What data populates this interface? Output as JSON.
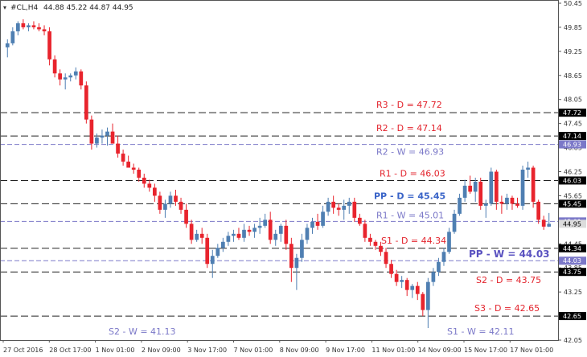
{
  "header": {
    "symbol": "#CL,H4",
    "ohlc": "44.88 45.22 44.87 44.95"
  },
  "colors": {
    "up": "#4f7fb2",
    "down": "#e8242d",
    "daily_line": "#222222",
    "weekly_line": "#7b78c8",
    "daily_label": "#e3242d",
    "weekly_label": "#7b78c8",
    "pp_daily": "#3a64c8",
    "pp_weekly": "#5a52c0",
    "axis_text": "#333333"
  },
  "chart_data": {
    "type": "candlestick",
    "ylim": [
      42.05,
      50.45
    ],
    "y_ticks": [
      "50.45",
      "49.85",
      "49.25",
      "48.65",
      "48.05",
      "47.45",
      "46.85",
      "46.25",
      "45.65",
      "45.05",
      "44.45",
      "43.85",
      "43.25",
      "42.65",
      "42.05"
    ],
    "x_ticks": [
      "27 Oct 2016",
      "28 Oct 17:00",
      "1 Nov 01:00",
      "2 Nov 09:00",
      "3 Nov 17:00",
      "7 Nov 01:00",
      "8 Nov 09:00",
      "9 Nov 17:00",
      "11 Nov 01:00",
      "14 Nov 09:00",
      "15 Nov 17:00",
      "17 Nov 01:00"
    ],
    "levels": [
      {
        "label": "R3 - D = 47.72",
        "value": 47.72,
        "kind": "daily",
        "axis_label": "47.72"
      },
      {
        "label": "R2 - D = 47.14",
        "value": 47.14,
        "kind": "daily",
        "axis_label": "47.14"
      },
      {
        "label": "R2 - W = 46.93",
        "value": 46.93,
        "kind": "weekly",
        "axis_label": "46.93"
      },
      {
        "label": "R1 - D = 46.03",
        "value": 46.03,
        "kind": "daily",
        "axis_label": "46.03"
      },
      {
        "label": "PP - D = 45.45",
        "value": 45.45,
        "kind": "pp_daily",
        "axis_label": "45.45"
      },
      {
        "label": "R1 - W = 45.01",
        "value": 45.01,
        "kind": "weekly",
        "axis_label": "45.01"
      },
      {
        "label": "S1 - D = 44.34",
        "value": 44.34,
        "kind": "daily",
        "axis_label": "44.34"
      },
      {
        "label": "PP - W = 44.03",
        "value": 44.03,
        "kind": "pp_weekly",
        "axis_label": "44.03"
      },
      {
        "label": "S2 - D = 43.75",
        "value": 43.75,
        "kind": "daily",
        "axis_label": "43.75"
      },
      {
        "label": "S3 - D = 42.65",
        "value": 42.65,
        "kind": "daily",
        "axis_label": "42.65"
      },
      {
        "label": "S2 - W = 41.13",
        "value": 41.13,
        "kind": "weekly_offscale"
      },
      {
        "label": "S1 - W = 42.11",
        "value": 42.11,
        "kind": "weekly_offscale"
      }
    ],
    "current_price": {
      "value": 44.95,
      "axis_label": "44.95"
    },
    "candles": [
      [
        49.35,
        49.55,
        49.1,
        49.45
      ],
      [
        49.45,
        49.85,
        49.4,
        49.75
      ],
      [
        49.75,
        50.0,
        49.65,
        49.95
      ],
      [
        49.95,
        50.05,
        49.8,
        49.85
      ],
      [
        49.85,
        49.95,
        49.75,
        49.9
      ],
      [
        49.9,
        50.0,
        49.8,
        49.85
      ],
      [
        49.85,
        49.95,
        49.75,
        49.8
      ],
      [
        49.8,
        49.9,
        49.65,
        49.75
      ],
      [
        49.75,
        49.85,
        48.9,
        49.05
      ],
      [
        49.05,
        49.15,
        48.6,
        48.7
      ],
      [
        48.7,
        48.8,
        48.4,
        48.55
      ],
      [
        48.55,
        48.7,
        48.3,
        48.6
      ],
      [
        48.6,
        48.7,
        48.5,
        48.65
      ],
      [
        48.65,
        48.85,
        48.55,
        48.75
      ],
      [
        48.75,
        48.8,
        48.3,
        48.4
      ],
      [
        48.4,
        48.5,
        47.45,
        47.55
      ],
      [
        47.55,
        47.65,
        46.8,
        46.95
      ],
      [
        46.95,
        47.2,
        46.85,
        47.1
      ],
      [
        47.1,
        47.3,
        46.95,
        47.15
      ],
      [
        47.15,
        47.35,
        46.9,
        47.25
      ],
      [
        47.25,
        47.45,
        47.1,
        46.95
      ],
      [
        46.95,
        47.15,
        46.6,
        46.7
      ],
      [
        46.7,
        46.8,
        46.4,
        46.5
      ],
      [
        46.5,
        46.65,
        46.4,
        46.35
      ],
      [
        46.35,
        46.45,
        46.2,
        46.3
      ],
      [
        46.3,
        46.35,
        46.0,
        46.1
      ],
      [
        46.1,
        46.2,
        45.85,
        45.95
      ],
      [
        45.95,
        46.05,
        45.75,
        45.85
      ],
      [
        45.85,
        45.95,
        45.5,
        45.65
      ],
      [
        45.65,
        45.75,
        45.2,
        45.3
      ],
      [
        45.3,
        45.55,
        45.1,
        45.45
      ],
      [
        45.45,
        45.75,
        45.35,
        45.65
      ],
      [
        45.65,
        45.8,
        45.4,
        45.5
      ],
      [
        45.5,
        45.6,
        45.2,
        45.3
      ],
      [
        45.3,
        45.45,
        44.85,
        44.95
      ],
      [
        44.95,
        45.05,
        44.45,
        44.55
      ],
      [
        44.55,
        44.8,
        44.5,
        44.7
      ],
      [
        44.7,
        44.85,
        44.45,
        44.6
      ],
      [
        44.6,
        44.7,
        43.85,
        43.95
      ],
      [
        43.95,
        44.3,
        43.6,
        44.15
      ],
      [
        44.15,
        44.45,
        44.1,
        44.35
      ],
      [
        44.35,
        44.6,
        44.25,
        44.5
      ],
      [
        44.5,
        44.75,
        44.4,
        44.65
      ],
      [
        44.65,
        44.8,
        44.5,
        44.7
      ],
      [
        44.7,
        44.85,
        44.55,
        44.6
      ],
      [
        44.6,
        44.95,
        44.5,
        44.8
      ],
      [
        44.8,
        44.9,
        44.65,
        44.75
      ],
      [
        44.75,
        44.95,
        44.6,
        44.85
      ],
      [
        44.85,
        45.1,
        44.7,
        44.9
      ],
      [
        44.9,
        45.2,
        44.85,
        45.05
      ],
      [
        45.05,
        45.25,
        44.45,
        44.55
      ],
      [
        44.55,
        44.8,
        44.4,
        44.7
      ],
      [
        44.7,
        44.95,
        44.5,
        44.9
      ],
      [
        44.9,
        45.05,
        44.3,
        44.45
      ],
      [
        44.45,
        44.6,
        43.5,
        43.85
      ],
      [
        43.85,
        44.2,
        43.3,
        44.1
      ],
      [
        44.1,
        44.7,
        44.0,
        44.55
      ],
      [
        44.55,
        44.95,
        44.45,
        44.85
      ],
      [
        44.85,
        45.1,
        44.7,
        45.0
      ],
      [
        45.0,
        45.2,
        44.8,
        44.9
      ],
      [
        44.9,
        45.4,
        44.85,
        45.25
      ],
      [
        45.25,
        45.6,
        45.15,
        45.5
      ],
      [
        45.5,
        45.65,
        45.2,
        45.35
      ],
      [
        45.35,
        45.45,
        45.15,
        45.3
      ],
      [
        45.3,
        45.55,
        45.05,
        45.4
      ],
      [
        45.4,
        45.6,
        45.2,
        45.5
      ],
      [
        45.5,
        45.6,
        45.0,
        45.1
      ],
      [
        45.1,
        45.2,
        44.9,
        44.95
      ],
      [
        44.95,
        45.05,
        44.5,
        44.6
      ],
      [
        44.6,
        44.7,
        44.4,
        44.5
      ],
      [
        44.5,
        44.55,
        44.3,
        44.4
      ],
      [
        44.4,
        44.5,
        44.15,
        44.25
      ],
      [
        44.25,
        44.35,
        43.85,
        43.95
      ],
      [
        43.95,
        44.05,
        43.6,
        43.7
      ],
      [
        43.7,
        43.8,
        43.4,
        43.5
      ],
      [
        43.5,
        43.65,
        43.35,
        43.55
      ],
      [
        43.55,
        43.6,
        43.15,
        43.3
      ],
      [
        43.3,
        43.45,
        43.1,
        43.4
      ],
      [
        43.4,
        43.5,
        43.05,
        43.2
      ],
      [
        43.2,
        43.25,
        42.65,
        42.8
      ],
      [
        42.8,
        43.6,
        42.35,
        43.5
      ],
      [
        43.5,
        43.85,
        43.4,
        43.75
      ],
      [
        43.75,
        44.1,
        43.65,
        44.0
      ],
      [
        44.0,
        44.35,
        43.9,
        44.25
      ],
      [
        44.25,
        44.85,
        44.2,
        44.75
      ],
      [
        44.75,
        45.3,
        44.7,
        45.2
      ],
      [
        45.2,
        45.7,
        45.15,
        45.6
      ],
      [
        45.6,
        46.05,
        45.5,
        45.9
      ],
      [
        45.9,
        46.15,
        45.7,
        45.75
      ],
      [
        45.75,
        46.1,
        45.5,
        46.0
      ],
      [
        46.0,
        46.1,
        45.3,
        45.4
      ],
      [
        45.4,
        45.55,
        45.1,
        45.45
      ],
      [
        45.45,
        46.35,
        45.4,
        46.25
      ],
      [
        46.25,
        46.3,
        45.3,
        45.5
      ],
      [
        45.5,
        45.65,
        45.2,
        45.45
      ],
      [
        45.45,
        45.7,
        45.3,
        45.6
      ],
      [
        45.6,
        45.65,
        45.3,
        45.45
      ],
      [
        45.45,
        45.6,
        45.35,
        45.4
      ],
      [
        45.4,
        46.4,
        45.3,
        46.3
      ],
      [
        46.3,
        46.5,
        46.1,
        46.35
      ],
      [
        46.35,
        46.4,
        45.35,
        45.5
      ],
      [
        45.5,
        45.55,
        44.95,
        45.05
      ],
      [
        45.05,
        45.15,
        44.8,
        44.88
      ],
      [
        44.88,
        45.22,
        44.87,
        44.95
      ]
    ]
  }
}
